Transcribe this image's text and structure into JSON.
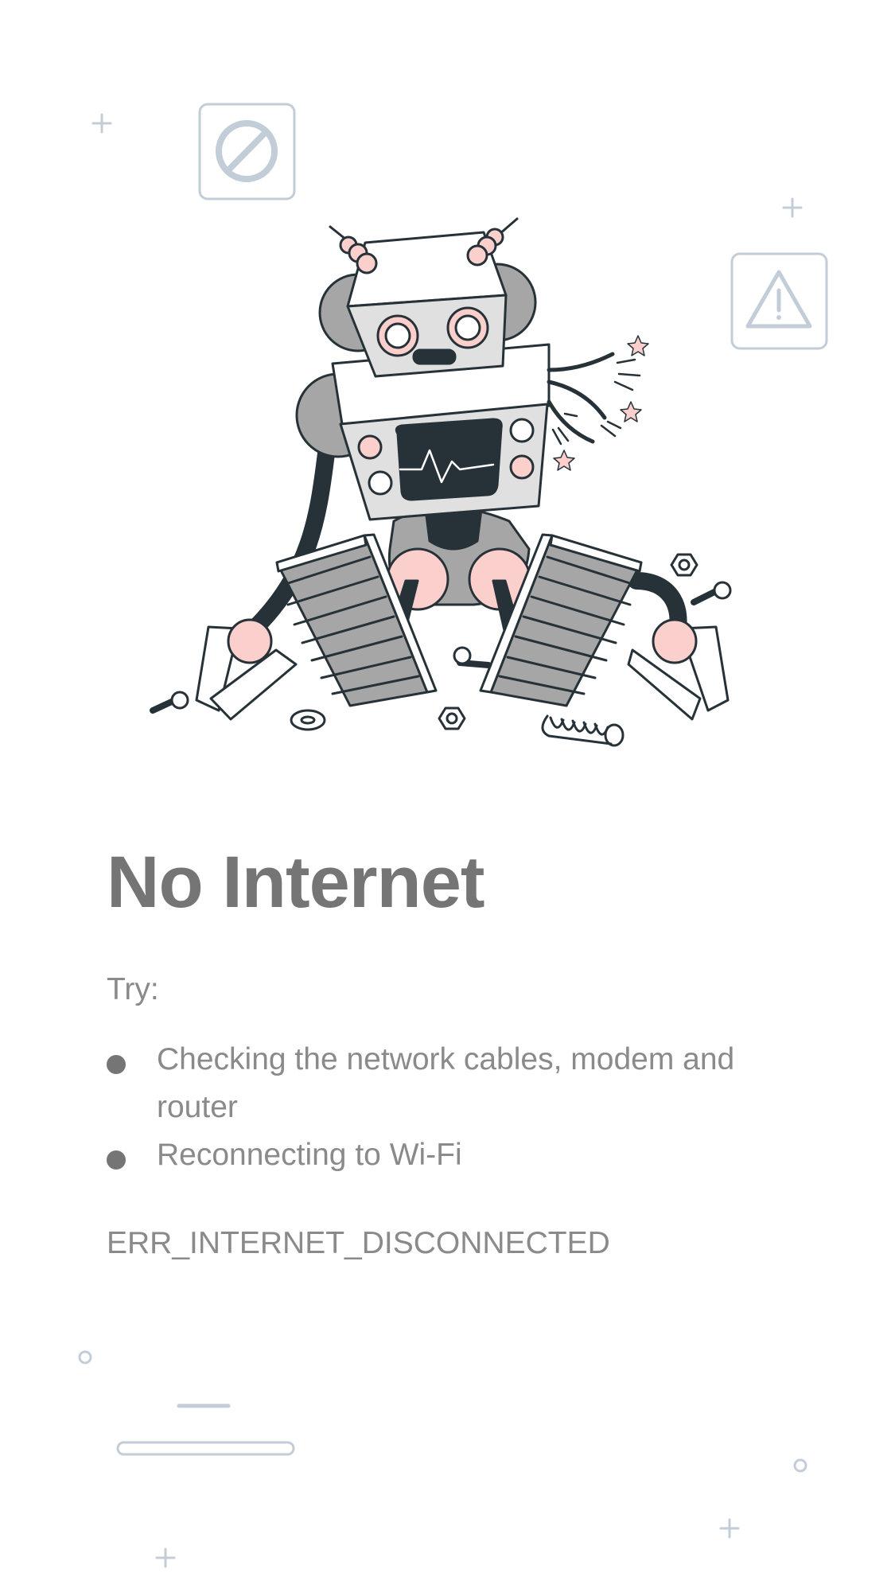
{
  "page": {
    "title": "No Internet",
    "try_label": "Try:",
    "suggestions": [
      {
        "text": "Checking the network cables, modem and router"
      },
      {
        "text": "Reconnecting to Wi-Fi"
      }
    ],
    "error_code": "ERR_INTERNET_DISCONNECTED"
  },
  "colors": {
    "title": "#757575",
    "body_text": "#8a8a8a",
    "decoration": "#c3cdd8",
    "robot_outline": "#263238",
    "robot_gray": "#a6a6a6",
    "robot_light": "#e0e0e0",
    "robot_pink": "#fbd0cc"
  },
  "illustration": {
    "subject": "broken-robot",
    "icons": [
      "no-entry-icon",
      "warning-icon"
    ]
  }
}
